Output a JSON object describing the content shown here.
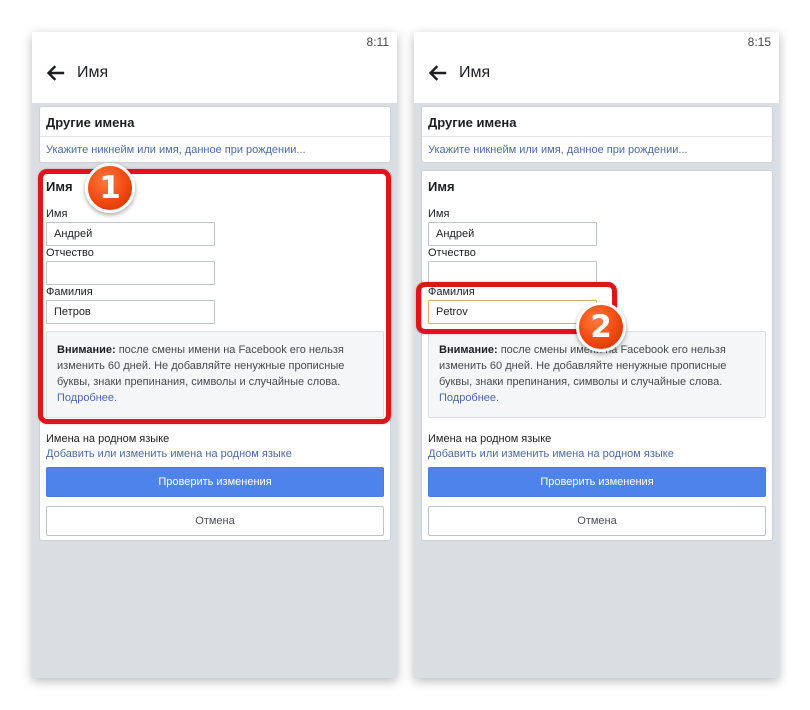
{
  "colors": {
    "accent_button": "#4f83ec",
    "link": "#4b68a6",
    "highlight": "#e0141b",
    "badge": "#f04810",
    "screen_background": "#dadde1"
  },
  "screens": [
    {
      "status_time": "8:11",
      "title": "Имя",
      "other_names": {
        "heading": "Другие имена",
        "link": "Укажите никнейм или имя, данное при рождении..."
      },
      "name_section": {
        "heading": "Имя",
        "first_label": "Имя",
        "first_value": "Андрей",
        "middle_label": "Отчество",
        "middle_value": "",
        "last_label": "Фамилия",
        "last_value": "Петров",
        "warning_bold": "Внимание:",
        "warning_text": " после смены имени на Facebook его нельзя изменить 60 дней. Не добавляйте ненужные прописные буквы, знаки препинания, символы и случайные слова. ",
        "warning_link": "Подробнее."
      },
      "native": {
        "label": "Имена на родном языке",
        "link": "Добавить или изменить имена на родном языке"
      },
      "review_button": "Проверить изменения",
      "cancel_button": "Отмена",
      "badge": "1"
    },
    {
      "status_time": "8:15",
      "title": "Имя",
      "other_names": {
        "heading": "Другие имена",
        "link": "Укажите никнейм или имя, данное при рождении..."
      },
      "name_section": {
        "heading": "Имя",
        "first_label": "Имя",
        "first_value": "Андрей",
        "middle_label": "Отчество",
        "middle_value": "",
        "last_label": "Фамилия",
        "last_value": "Petrov",
        "warning_bold": "Внимание:",
        "warning_text": " после смены имени на Facebook его нельзя изменить 60 дней. Не добавляйте ненужные прописные буквы, знаки препинания, символы и случайные слова. ",
        "warning_link": "Подробнее."
      },
      "native": {
        "label": "Имена на родном языке",
        "link": "Добавить или изменить имена на родном языке"
      },
      "review_button": "Проверить изменения",
      "cancel_button": "Отмена",
      "badge": "2"
    }
  ]
}
